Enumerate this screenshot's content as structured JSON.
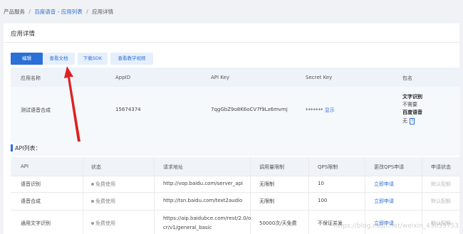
{
  "breadcrumb": {
    "root": "产品服务",
    "sep1": "/",
    "product": "百度语音 - 应用列表",
    "sep2": "/",
    "current": "应用详情"
  },
  "page_title": "应用详情",
  "toolbar": {
    "edit": "编辑",
    "docs": "查看文档",
    "sdk": "下载SDK",
    "video": "查看教学视频"
  },
  "app_table": {
    "headers": [
      "应用名称",
      "AppID",
      "API Key",
      "Secret Key",
      "包名"
    ],
    "row": {
      "name": "测试语音合成",
      "appid": "15674374",
      "api_key": "7qgGbZ9o8K6oCV7f9Lx6mvmj",
      "secret_masked": "*******",
      "secret_show": "显示",
      "pkg_1_label": "文字识别",
      "pkg_1_value": "不需要",
      "pkg_2_label": "百度语音",
      "pkg_2_value": "无",
      "pkg_2_help": "?"
    }
  },
  "api_section": {
    "title": "API列表：",
    "headers": [
      "API",
      "状态",
      "请求地址",
      "调用量限制",
      "QPS限制",
      "更改QPS申请",
      "申请状态"
    ],
    "rows": [
      {
        "api": "语音识别",
        "status": "免费使用",
        "url": "http://vop.baidu.com/server_api",
        "limit": "无限制",
        "qps": "10",
        "apply": "立即申请",
        "apply_status": "默认配额"
      },
      {
        "api": "语音合成",
        "status": "免费使用",
        "url": "http://tsn.baidu.com/text2audio",
        "limit": "无限制",
        "qps": "100",
        "apply": "立即申请",
        "apply_status": "默认配额"
      },
      {
        "api": "通用文字识别",
        "status": "免费使用",
        "url_line1": "https://aip.baidubce.com/rest/2.0/o",
        "url_line2": "cr/v1/general_basic",
        "limit": "50000次/天免费",
        "qps": "不保证并发",
        "apply": "立即申请",
        "apply_status": "默认配额"
      }
    ]
  },
  "watermark": "https://blog.csdn.net/weixin_43053753",
  "colors": {
    "accent": "#2b6fd8",
    "arrow": "#e02020"
  }
}
